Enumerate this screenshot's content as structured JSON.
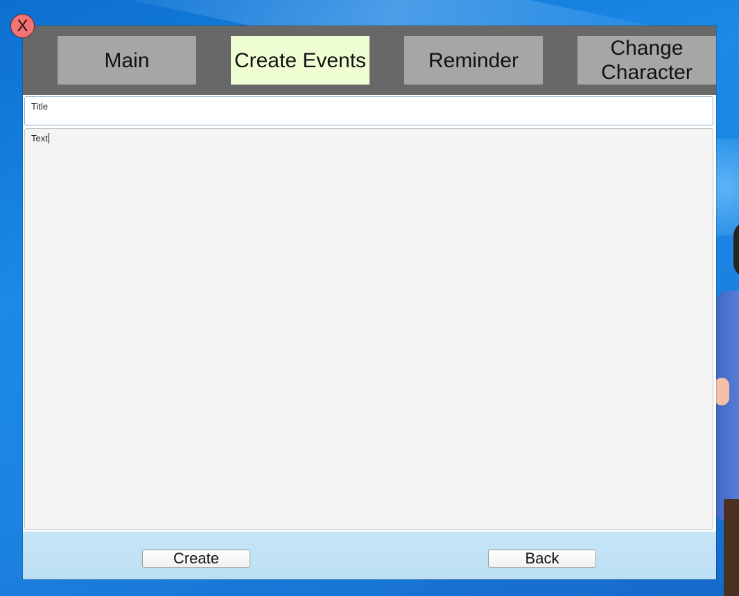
{
  "window": {
    "close_label": "X"
  },
  "tabs": [
    {
      "label": "Main",
      "active": false
    },
    {
      "label": "Create Events",
      "active": true
    },
    {
      "label": "Reminder",
      "active": false
    },
    {
      "label": "Change Character",
      "active": false
    }
  ],
  "form": {
    "title_placeholder": "Title",
    "text_placeholder": "Text"
  },
  "actions": {
    "create_label": "Create",
    "back_label": "Back"
  },
  "colors": {
    "tab_bar": "#686868",
    "tab_inactive": "#a6a6a6",
    "tab_active": "#eefed2",
    "close_button": "#f27474",
    "footer": "#c6e6f7"
  }
}
